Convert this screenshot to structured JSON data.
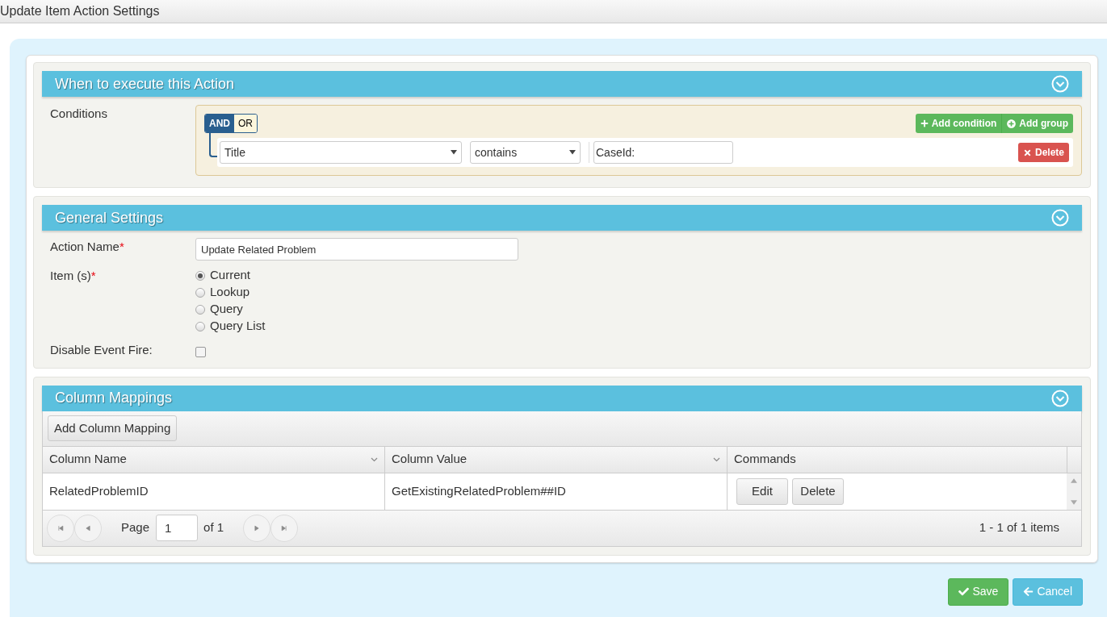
{
  "window": {
    "title": "Update Item Action Settings"
  },
  "conditions_panel": {
    "title": "When to execute this Action",
    "label": "Conditions",
    "logic": [
      {
        "label": "AND",
        "selected": true
      },
      {
        "label": "OR",
        "selected": false
      }
    ],
    "add_condition": "Add condition",
    "add_group": "Add group",
    "rule": {
      "field": "Title",
      "operator": "contains",
      "value": "CaseId:",
      "delete": "Delete"
    }
  },
  "general_panel": {
    "title": "General Settings",
    "action_name": {
      "label": "Action Name",
      "required_mark": "*",
      "value": "Update Related Problem"
    },
    "items": {
      "label": "Item (s)",
      "required_mark": "*",
      "options": [
        {
          "label": "Current",
          "selected": true
        },
        {
          "label": "Lookup",
          "selected": false
        },
        {
          "label": "Query",
          "selected": false
        },
        {
          "label": "Query List",
          "selected": false
        }
      ]
    },
    "disable_event_fire": {
      "label": "Disable Event Fire:",
      "checked": false
    }
  },
  "mappings_panel": {
    "title": "Column Mappings",
    "add_button": "Add Column Mapping",
    "columns": [
      {
        "label": "Column Name",
        "sortable": true
      },
      {
        "label": "Column Value",
        "sortable": true
      },
      {
        "label": "Commands",
        "sortable": false
      }
    ],
    "rows": [
      {
        "cells": [
          "RelatedProblemID",
          "GetExistingRelatedProblem##ID"
        ],
        "commands": [
          "Edit",
          "Delete"
        ]
      }
    ],
    "pager": {
      "page_label": "Page",
      "page": "1",
      "of": "of 1",
      "summary": "1 - 1 of 1 items"
    }
  },
  "footer_buttons": [
    {
      "kind": "save",
      "label": "Save"
    },
    {
      "kind": "cancel",
      "label": "Cancel"
    }
  ]
}
